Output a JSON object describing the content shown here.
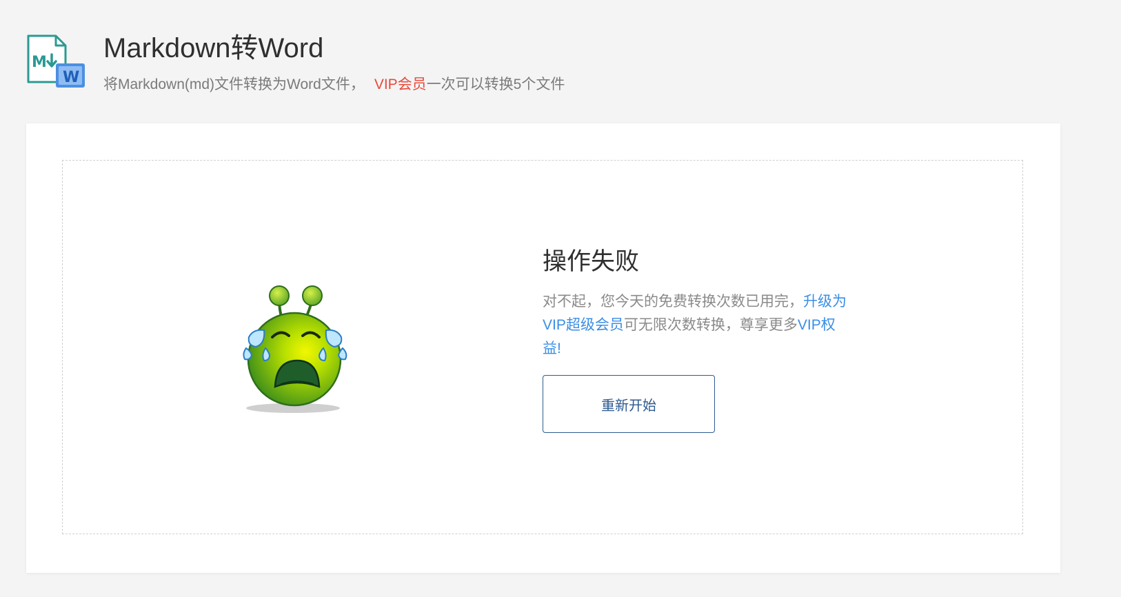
{
  "header": {
    "title": "Markdown转Word",
    "subtitle_prefix": "将Markdown(md)文件转换为Word文件，",
    "subtitle_vip": "VIP会员",
    "subtitle_suffix": "一次可以转换5个文件",
    "logo_md_text": "M",
    "logo_word_text": "W"
  },
  "result": {
    "illustration": "crying-alien-emoji",
    "title": "操作失败",
    "message_prefix": "对不起，您今天的免费转换次数已用完，",
    "upgrade_link": "升级为VIP超级会员",
    "message_middle": "可无限次数转换，尊享更多",
    "benefits_link": "VIP权益",
    "message_end": "!",
    "restart_label": "重新开始"
  },
  "colors": {
    "vip_red": "#e84a3b",
    "link_blue": "#3a8ee6",
    "button_border": "#2c5a8f",
    "background": "#f4f4f4"
  }
}
